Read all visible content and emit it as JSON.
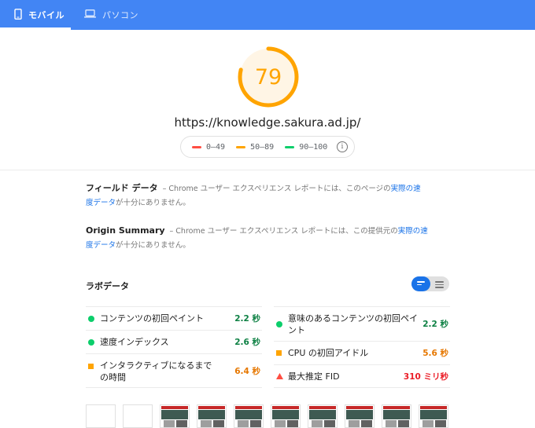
{
  "tabs": [
    {
      "label": "モバイル",
      "icon": "mobile-phone-icon",
      "active": true
    },
    {
      "label": "パソコン",
      "icon": "laptop-icon",
      "active": false
    }
  ],
  "score": {
    "value": "79",
    "fraction": 0.79,
    "color": "#ffa400"
  },
  "url": "https://knowledge.sakura.ad.jp/",
  "legend": [
    {
      "label": "0–49",
      "color": "#ff4e42"
    },
    {
      "label": "50–89",
      "color": "#ffa400"
    },
    {
      "label": "90–100",
      "color": "#0cce6b"
    }
  ],
  "field_data": {
    "title": "フィールド データ",
    "sep": "–",
    "note": "Chrome ユーザー エクスペリエンス レポートには、このページの",
    "link": "実際の速度データ",
    "tail": "が十分にありません。"
  },
  "origin_summary": {
    "title": "Origin Summary",
    "sep": "–",
    "note": "Chrome ユーザー エクスペリエンス レポートには、この提供元の",
    "link": "実際の速度データ",
    "tail": "が十分にありません。"
  },
  "lab": {
    "title": "ラボデータ",
    "metrics_left": [
      {
        "name": "コンテンツの初回ペイント",
        "value": "2.2 秒",
        "status": "good"
      },
      {
        "name": "速度インデックス",
        "value": "2.6 秒",
        "status": "good"
      },
      {
        "name": "インタラクティブになるまでの時間",
        "value": "6.4 秒",
        "status": "average"
      }
    ],
    "metrics_right": [
      {
        "name": "意味のあるコンテンツの初回ペイント",
        "value": "2.2 秒",
        "status": "good"
      },
      {
        "name": "CPU の初回アイドル",
        "value": "5.6 秒",
        "status": "average"
      },
      {
        "name": "最大推定 FID",
        "value": "310 ミリ秒",
        "status": "fail"
      }
    ]
  },
  "colors": {
    "good": "#0cce6b",
    "average": "#ffa400",
    "fail": "#ff4e42",
    "good_text": "#0d8043",
    "average_text": "#e67700",
    "fail_text": "#eb1c26",
    "tabbar": "#4285f4",
    "link": "#1a73e8"
  }
}
